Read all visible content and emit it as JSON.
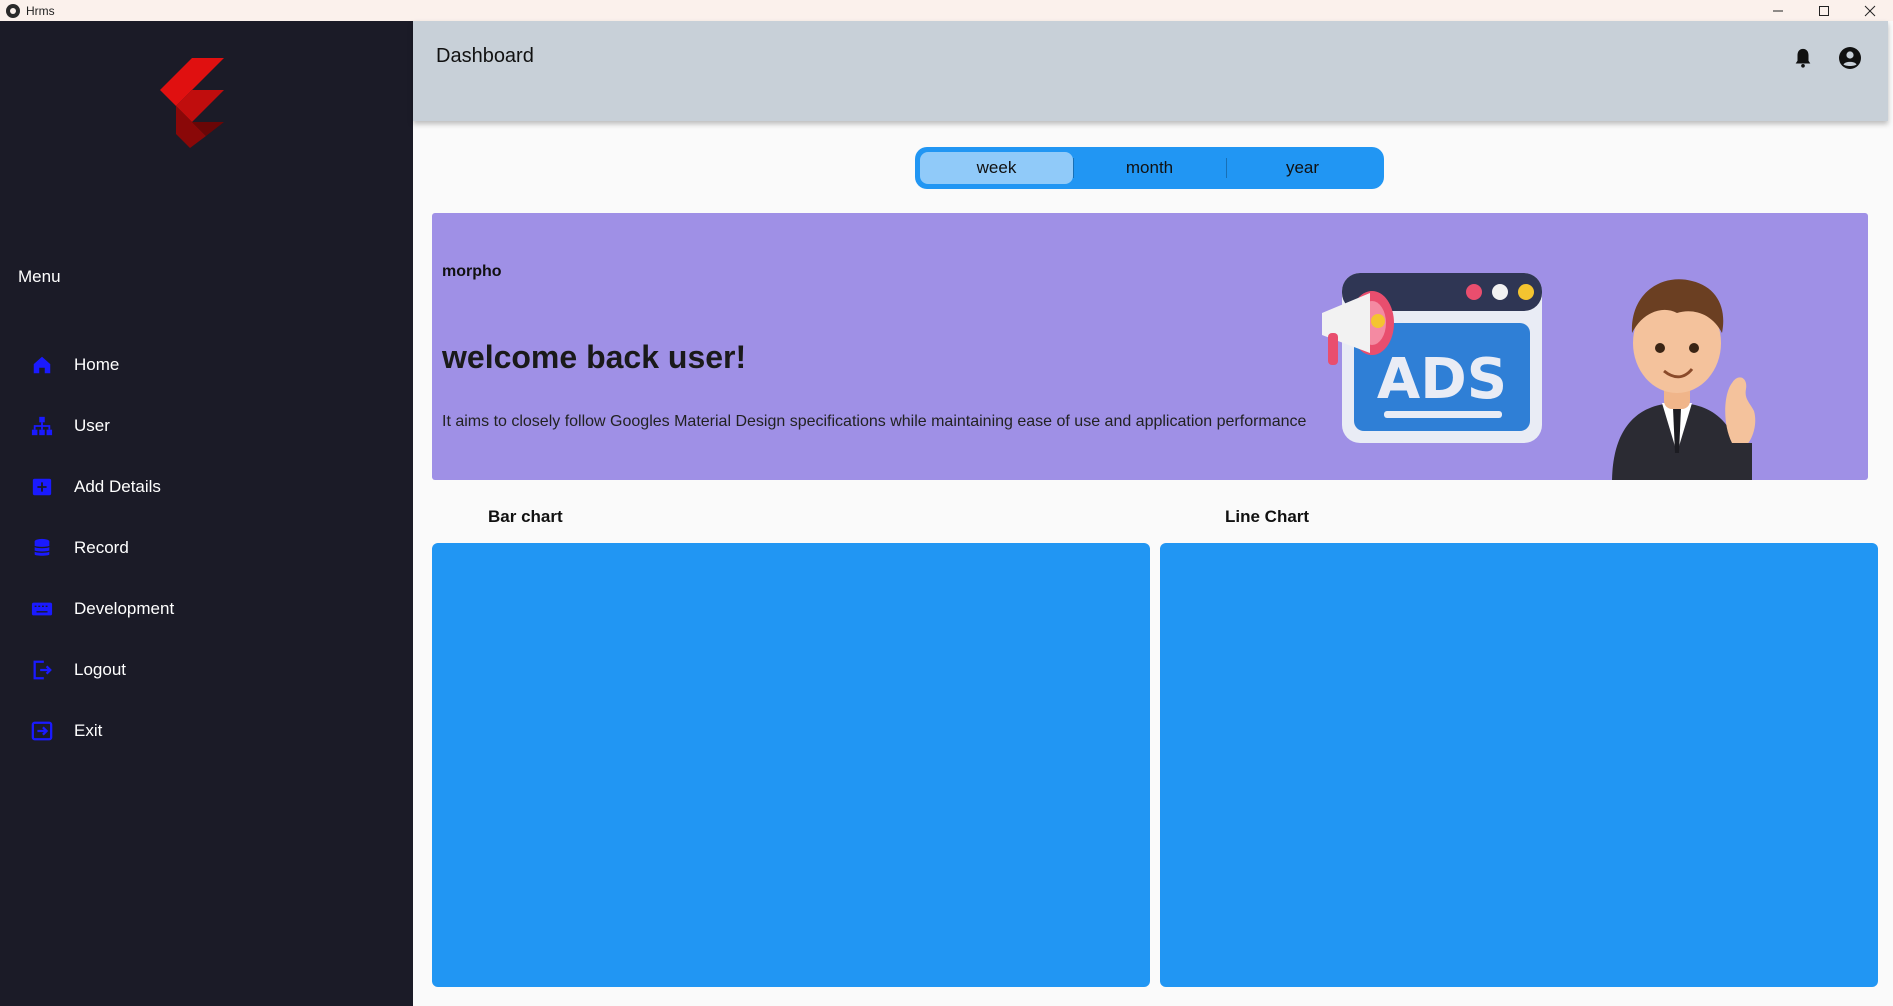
{
  "window": {
    "title": "Hrms"
  },
  "sidebar": {
    "menu_heading": "Menu",
    "items": [
      {
        "label": "Home",
        "icon": "home-icon"
      },
      {
        "label": "User",
        "icon": "sitemap-icon"
      },
      {
        "label": "Add Details",
        "icon": "add-box-icon"
      },
      {
        "label": "Record",
        "icon": "database-icon"
      },
      {
        "label": "Development",
        "icon": "keyboard-icon"
      },
      {
        "label": "Logout",
        "icon": "logout-icon"
      },
      {
        "label": "Exit",
        "icon": "exit-icon"
      }
    ]
  },
  "header": {
    "title": "Dashboard"
  },
  "period_toggle": {
    "options": [
      "week",
      "month",
      "year"
    ],
    "selected": "week"
  },
  "banner": {
    "brand": "morpho",
    "headline": "welcome back user!",
    "description": "It aims to closely follow Googles Material Design specifications while maintaining ease of use and application performance",
    "ads_text": "ADS"
  },
  "charts": {
    "bar_title": "Bar chart",
    "line_title": "Line Chart"
  },
  "colors": {
    "sidebar_bg": "#1b1b27",
    "accent_blue": "#2196f3",
    "active_segment": "#90caf9",
    "banner_bg": "#9f90e6",
    "header_bg": "#c8d0d8",
    "icon_blue": "#1a1aff",
    "logo_red": "#e01010"
  }
}
